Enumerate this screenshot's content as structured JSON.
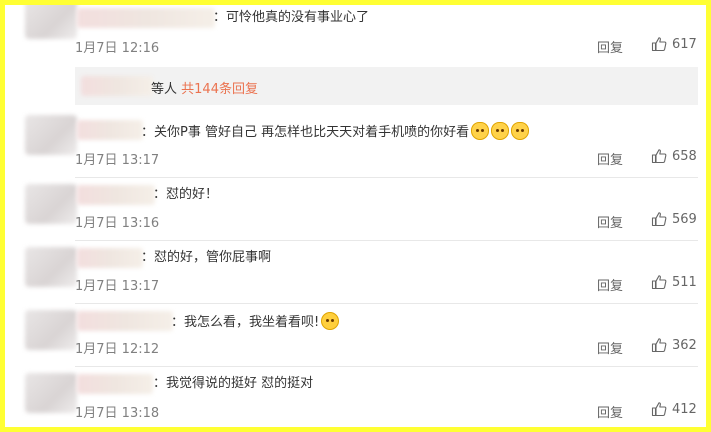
{
  "comments": [
    {
      "text": "：可怜他真的没有事业心了",
      "time": "1月7日 12:16",
      "reply_label": "回复",
      "likes": "617",
      "emojis": []
    },
    {
      "text": "：关你P事 管好自己 再怎样也比天天对着手机喷的你好看",
      "time": "1月7日 13:17",
      "reply_label": "回复",
      "likes": "658",
      "emojis": [
        "cat-face",
        "cat-face",
        "cat-face"
      ]
    },
    {
      "text": "：怼的好！",
      "time": "1月7日 13:16",
      "reply_label": "回复",
      "likes": "569",
      "emojis": []
    },
    {
      "text": "：怼的好，管你屁事啊",
      "time": "1月7日 13:17",
      "reply_label": "回复",
      "likes": "511",
      "emojis": []
    },
    {
      "text": "：我怎么看，我坐着看呗!",
      "time": "1月7日 12:12",
      "reply_label": "回复",
      "likes": "362",
      "emojis": [
        "kiss-face"
      ]
    },
    {
      "text": "：我觉得说的挺好 怼的挺对",
      "time": "1月7日 13:18",
      "reply_label": "回复",
      "likes": "412",
      "emojis": []
    }
  ],
  "sub_replies": {
    "prefix": "等人",
    "link": "共144条回复"
  },
  "colors": {
    "frame": "#ffff33",
    "link": "#eb7350",
    "muted": "#808080"
  }
}
